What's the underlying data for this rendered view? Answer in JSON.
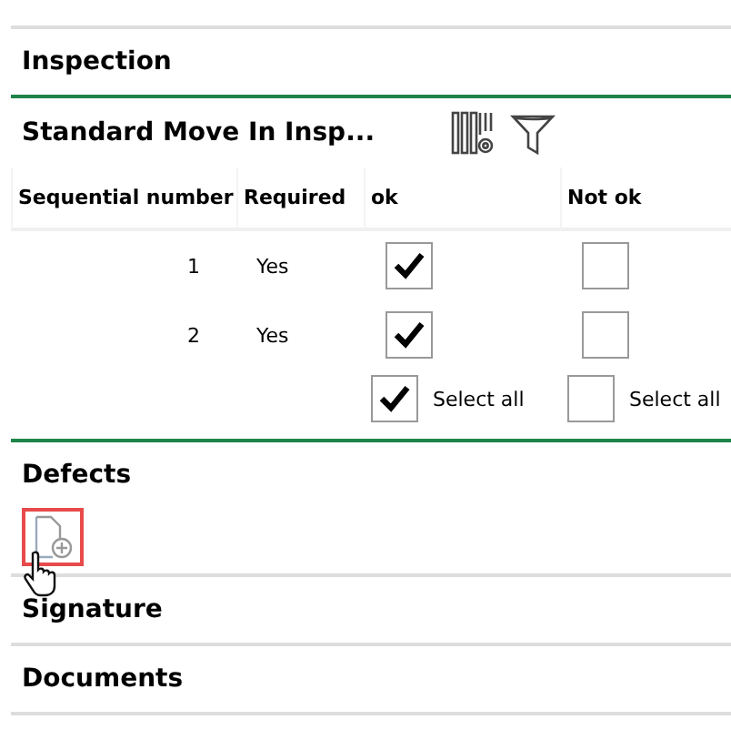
{
  "sections": [
    {
      "title": "Inspection",
      "kind": "inspection",
      "accent": true
    },
    {
      "title": "Defects",
      "kind": "defects",
      "accent": false
    },
    {
      "title": "Signature",
      "kind": "plain",
      "accent": false
    },
    {
      "title": "Documents",
      "kind": "plain",
      "accent": false
    }
  ],
  "inspection": {
    "title": "Standard Move In Insp...",
    "columns": [
      "Sequential number",
      "Required",
      "ok",
      "Not ok"
    ],
    "rows": [
      {
        "number": "1",
        "required": "Yes",
        "ok": true,
        "not_ok": false
      },
      {
        "number": "2",
        "required": "Yes",
        "ok": true,
        "not_ok": false
      }
    ],
    "select_all": [
      {
        "label": "Select all",
        "checked": true
      },
      {
        "label": "Select all",
        "checked": false
      }
    ]
  },
  "defects": {
    "add_highlighted": true
  }
}
